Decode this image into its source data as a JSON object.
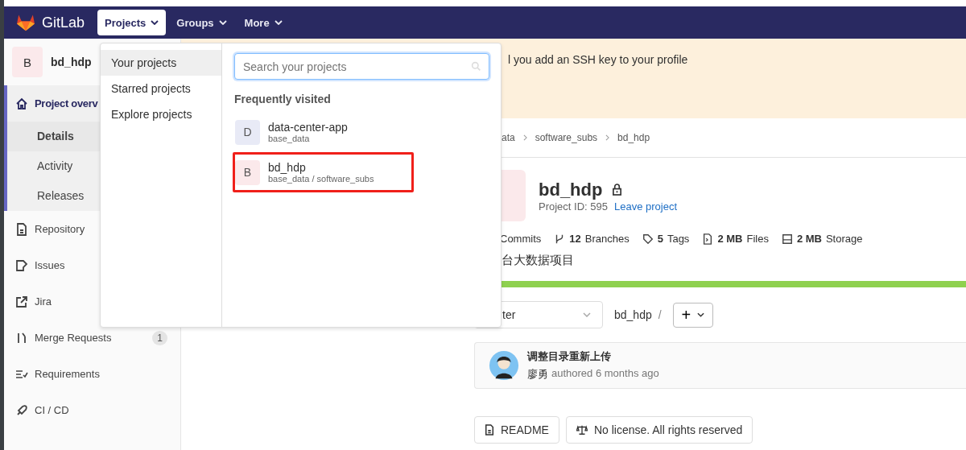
{
  "navbar": {
    "brand": "GitLab",
    "menus": [
      {
        "label": "Projects",
        "selected": true
      },
      {
        "label": "Groups",
        "selected": false
      },
      {
        "label": "More",
        "selected": false
      }
    ]
  },
  "sidebar": {
    "project": {
      "avatar": "B",
      "name": "bd_hdp"
    },
    "items": [
      {
        "label": "Project overv",
        "selected": true,
        "children": [
          {
            "label": "Details",
            "selected": true
          },
          {
            "label": "Activity",
            "selected": false
          },
          {
            "label": "Releases",
            "selected": false
          }
        ]
      },
      {
        "label": "Repository",
        "selected": false
      },
      {
        "label": "Issues",
        "selected": false
      },
      {
        "label": "Jira",
        "selected": false
      },
      {
        "label": "Merge Requests",
        "selected": false,
        "count": "1"
      },
      {
        "label": "Requirements",
        "selected": false
      },
      {
        "label": "CI / CD",
        "selected": false
      }
    ]
  },
  "alert": {
    "text": "l you add an SSH key to your profile"
  },
  "breadcrumb": [
    "ata",
    "software_subs",
    "bd_hdp"
  ],
  "project": {
    "name": "bd_hdp",
    "id_label": "Project ID: 595",
    "leave_link": "Leave project",
    "stats": [
      {
        "label": "Commits"
      },
      {
        "count": "12",
        "label": "Branches"
      },
      {
        "count": "5",
        "label": "Tags"
      },
      {
        "count": "2 MB",
        "label": "Files"
      },
      {
        "count": "2 MB",
        "label": "Storage"
      }
    ],
    "description": "台大数据项目",
    "language_bar": {
      "level": 1
    }
  },
  "branch_select": {
    "value": "ter"
  },
  "path": {
    "root": "bd_hdp",
    "separator": "/",
    "add": "+"
  },
  "commit": {
    "title": "调整目录重新上传",
    "author": "廖勇",
    "meta": "authored 6 months ago"
  },
  "buttons": [
    "README",
    "No license. All rights reserved"
  ],
  "dropdown": {
    "menu": [
      {
        "label": "Your projects",
        "selected": true
      },
      {
        "label": "Starred projects",
        "selected": false
      },
      {
        "label": "Explore projects",
        "selected": false
      }
    ],
    "search": {
      "placeholder": "Search your projects"
    },
    "heading": "Frequently visited",
    "projects": [
      {
        "avatar": "D",
        "name": "data-center-app",
        "namespace": "base_data",
        "color": "#e8eaf6",
        "annotated": false
      },
      {
        "avatar": "B",
        "name": "bd_hdp",
        "namespace": "base_data / software_subs",
        "color": "#fbe9eb",
        "annotated": true
      }
    ]
  }
}
